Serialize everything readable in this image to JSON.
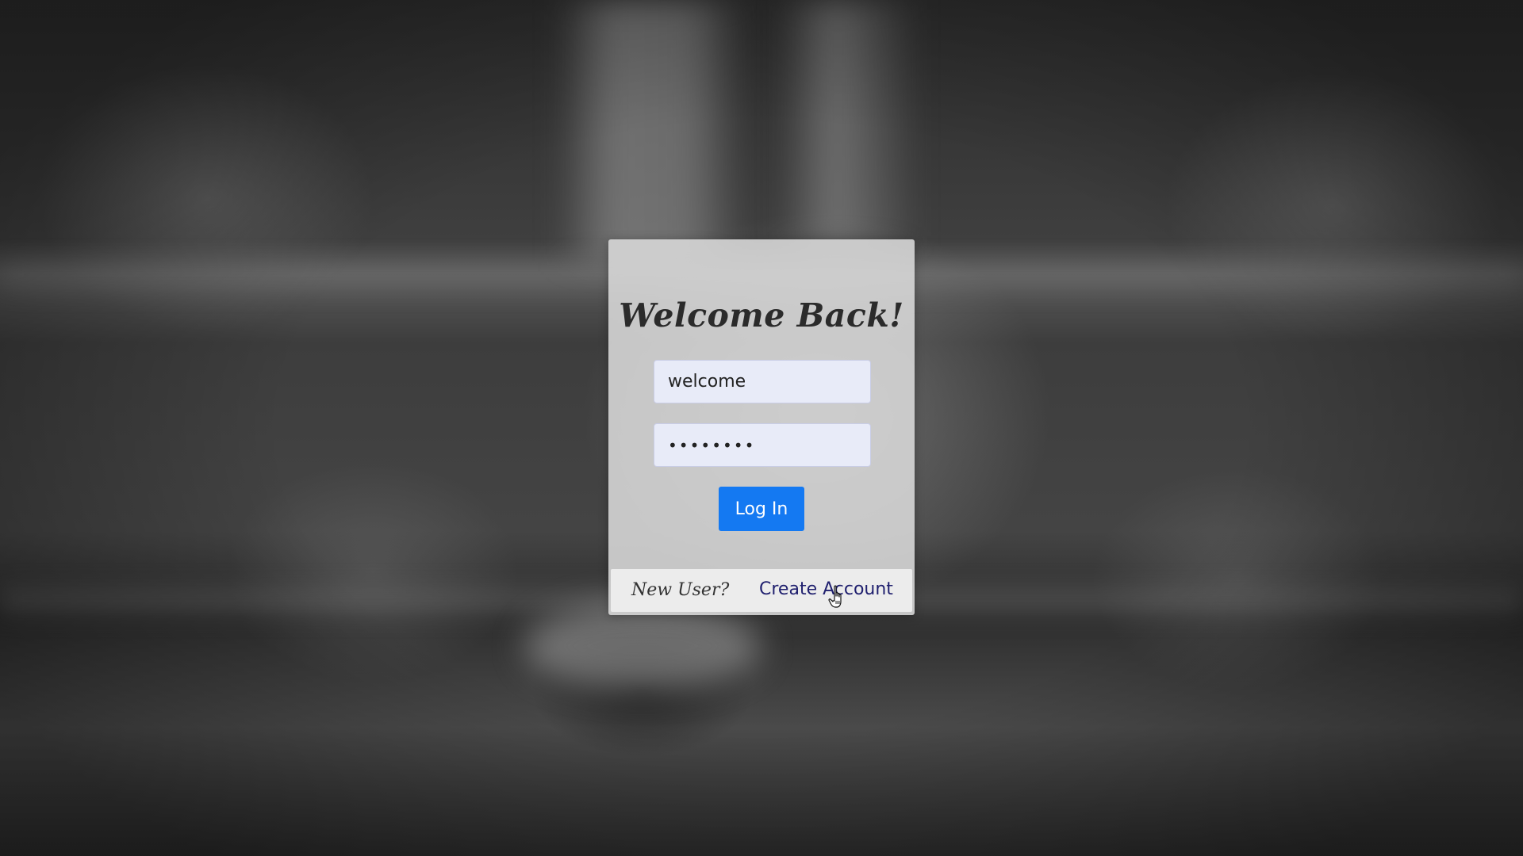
{
  "login_card": {
    "title": "Welcome Back!",
    "username_value": "welcome",
    "password_value": "••••••••",
    "login_label": "Log In"
  },
  "footer": {
    "prompt": "New User?",
    "create_account_label": "Create Account"
  },
  "colors": {
    "accent": "#1479f2",
    "link": "#1f1f6e",
    "card": "#dadada",
    "input_bg": "#e8ebf8"
  },
  "icons": {
    "cursor": "hand-pointer-icon"
  }
}
